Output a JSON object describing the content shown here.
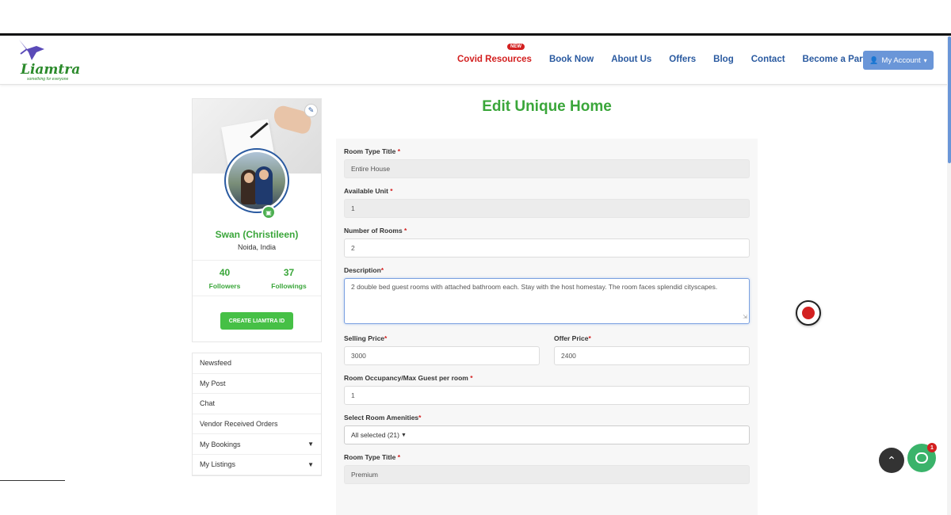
{
  "nav": {
    "logo_text": "Liamtra",
    "logo_tagline": "something for everyone",
    "new_badge": "NEW",
    "links": [
      "Covid Resources",
      "Book Now",
      "About Us",
      "Offers",
      "Blog",
      "Contact",
      "Become a Partner"
    ],
    "account_label": "My Account"
  },
  "profile": {
    "name": "Swan (Christileen)",
    "location": "Noida, India",
    "followers_count": "40",
    "followers_label": "Followers",
    "followings_count": "37",
    "followings_label": "Followings",
    "create_id_label": "CREATE LIAMTRA ID"
  },
  "menu": {
    "items": [
      "Newsfeed",
      "My Post",
      "Chat",
      "Vendor Received Orders",
      "My Bookings",
      "My Listings"
    ]
  },
  "form": {
    "title": "Edit Unique Home",
    "room_type_title_label": "Room Type Title",
    "room_type_title_value": "Entire House",
    "available_unit_label": "Available Unit",
    "available_unit_value": "1",
    "number_of_rooms_label": "Number of Rooms",
    "number_of_rooms_value": "2",
    "description_label": "Description",
    "description_value": "2 double bed guest rooms with attached bathroom each. Stay with the host homestay. The room faces splendid cityscapes.",
    "selling_price_label": "Selling Price",
    "selling_price_value": "3000",
    "offer_price_label": "Offer Price",
    "offer_price_value": "2400",
    "occupancy_label": "Room Occupancy/Max Guest per room",
    "occupancy_value": "1",
    "amenities_label": "Select Room Amenities",
    "amenities_value": "All selected (21)",
    "room_type_title2_label": "Room Type Title",
    "room_type_title2_value": "Premium"
  },
  "widgets": {
    "chat_badge": "1"
  },
  "colors": {
    "brand_green": "#3aa63a",
    "nav_blue": "#2a5aa0",
    "covid_red": "#d32020",
    "account_button": "#6a96d8"
  }
}
